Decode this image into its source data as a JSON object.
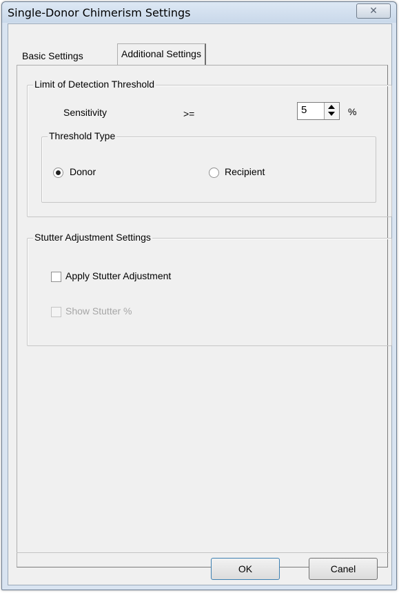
{
  "window": {
    "title": "Single-Donor Chimerism Settings",
    "close_glyph": "✕"
  },
  "tabs": [
    {
      "label": "Basic Settings",
      "active": false
    },
    {
      "label": "Additional Settings",
      "active": true
    }
  ],
  "lod": {
    "legend": "Limit of Detection Threshold",
    "sensitivity_label": "Sensitivity",
    "operator": ">=",
    "sensitivity_value": "5",
    "unit": "%"
  },
  "threshold_type": {
    "legend": "Threshold Type",
    "options": [
      {
        "label": "Donor",
        "checked": true
      },
      {
        "label": "Recipient",
        "checked": false
      }
    ]
  },
  "stutter": {
    "legend": "Stutter Adjustment Settings",
    "apply_label": "Apply Stutter Adjustment",
    "apply_checked": false,
    "show_label": "Show Stutter %",
    "show_checked": false,
    "show_enabled": false
  },
  "buttons": {
    "ok": "OK",
    "cancel": "Canel"
  }
}
